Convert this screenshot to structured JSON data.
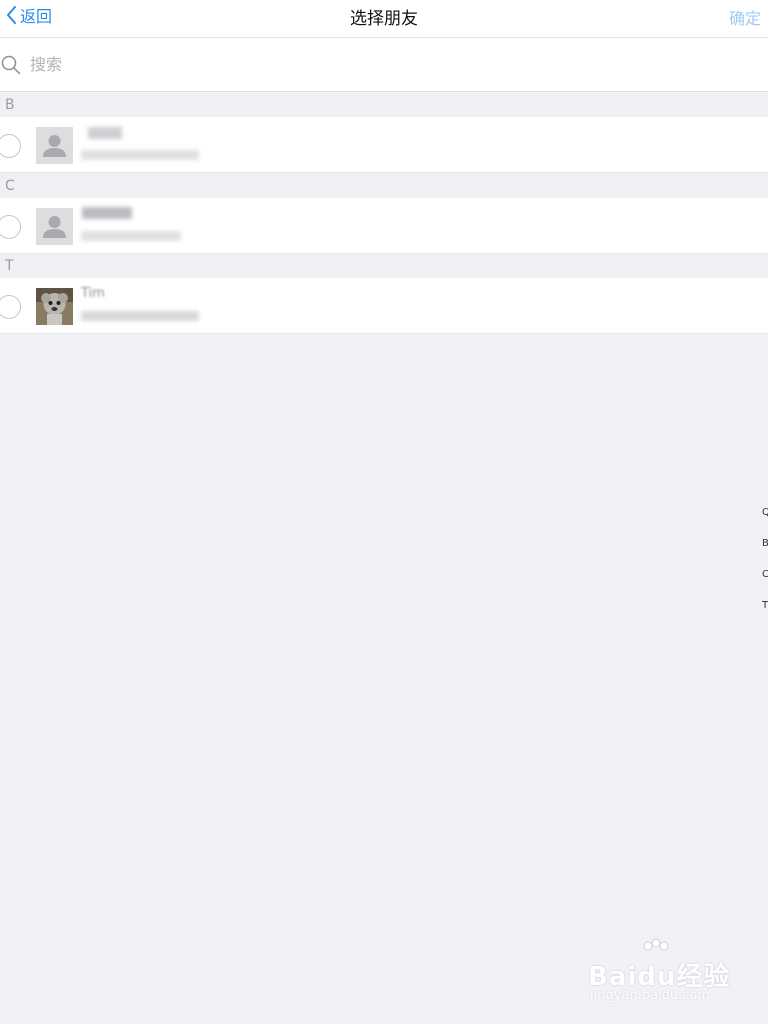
{
  "nav": {
    "back_label": "返回",
    "title": "选择朋友",
    "confirm_label": "确定"
  },
  "search": {
    "placeholder": "搜索",
    "value": ""
  },
  "sections": [
    {
      "letter": "B",
      "contacts": [
        {
          "name": "",
          "avatar": "default-avatar"
        }
      ]
    },
    {
      "letter": "C",
      "contacts": [
        {
          "name": "",
          "avatar": "default-avatar"
        }
      ]
    },
    {
      "letter": "T",
      "contacts": [
        {
          "name": "Tim",
          "avatar": "dog-photo-avatar"
        }
      ]
    }
  ],
  "index_bar": [
    "Q",
    "B",
    "C",
    "T"
  ],
  "watermark": {
    "brand": "Baidu经验",
    "url": "jingyan.baidu.com"
  },
  "colors": {
    "accent": "#2a8cf0",
    "confirm_disabled": "#9fcbf3",
    "background": "#f2f2f6",
    "section_header": "#efeff4"
  }
}
